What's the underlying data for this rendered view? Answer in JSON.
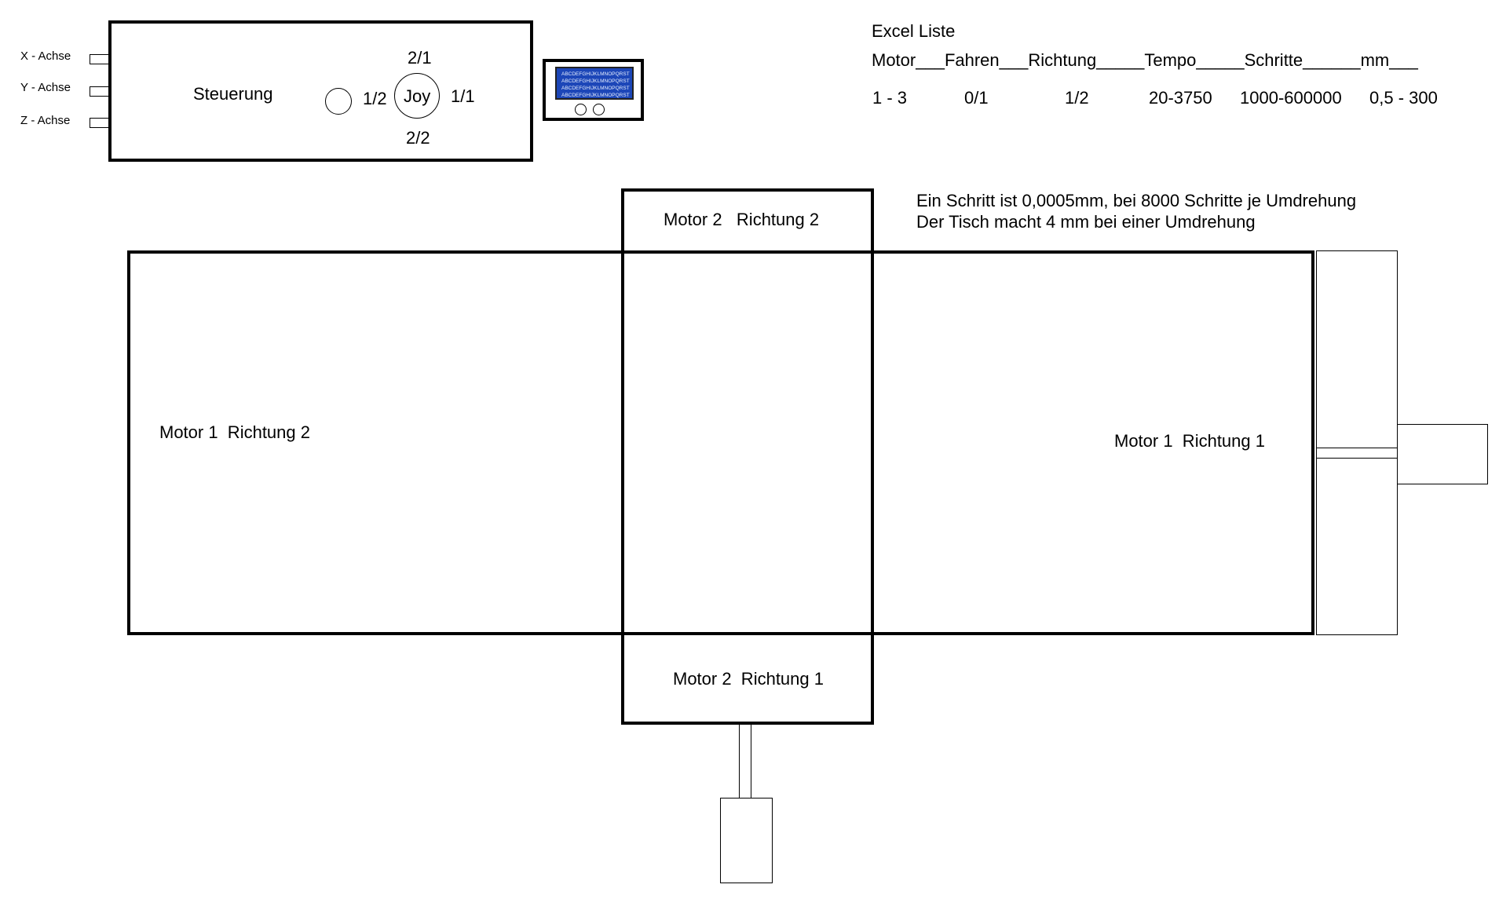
{
  "controller": {
    "label": "Steuerung",
    "axes": [
      "X - Achse",
      "Y - Achse",
      "Z - Achse"
    ],
    "joystick": {
      "label": "Joy",
      "up": "2/1",
      "down": "2/2",
      "left": "1/2",
      "right": "1/1"
    }
  },
  "lcd": {
    "lines": [
      "ABCDEFGHIJKLMNOPQRST",
      "ABCDEFGHIJKLMNOPQRST",
      "ABCDEFGHIJKLMNOPQRST",
      "ABCDEFGHIJKLMNOPQRST"
    ],
    "screen_color": "#1c46b8"
  },
  "excel": {
    "title": "Excel Liste",
    "header": "Motor___Fahren___Richtung_____Tempo_____Schritte______mm___",
    "values": [
      "1 - 3",
      "0/1",
      "1/2",
      "20-3750",
      "1000-600000",
      "0,5 - 300"
    ]
  },
  "notes": [
    "Ein Schritt ist 0,0005mm, bei 8000 Schritte je Umdrehung",
    "Der Tisch macht 4 mm bei einer Umdrehung"
  ],
  "table": {
    "motor1_dir2": "Motor 1  Richtung 2",
    "motor1_dir1": "Motor 1  Richtung 1",
    "motor2_dir2": "Motor 2   Richtung 2",
    "motor2_dir1": "Motor 2  Richtung 1"
  }
}
